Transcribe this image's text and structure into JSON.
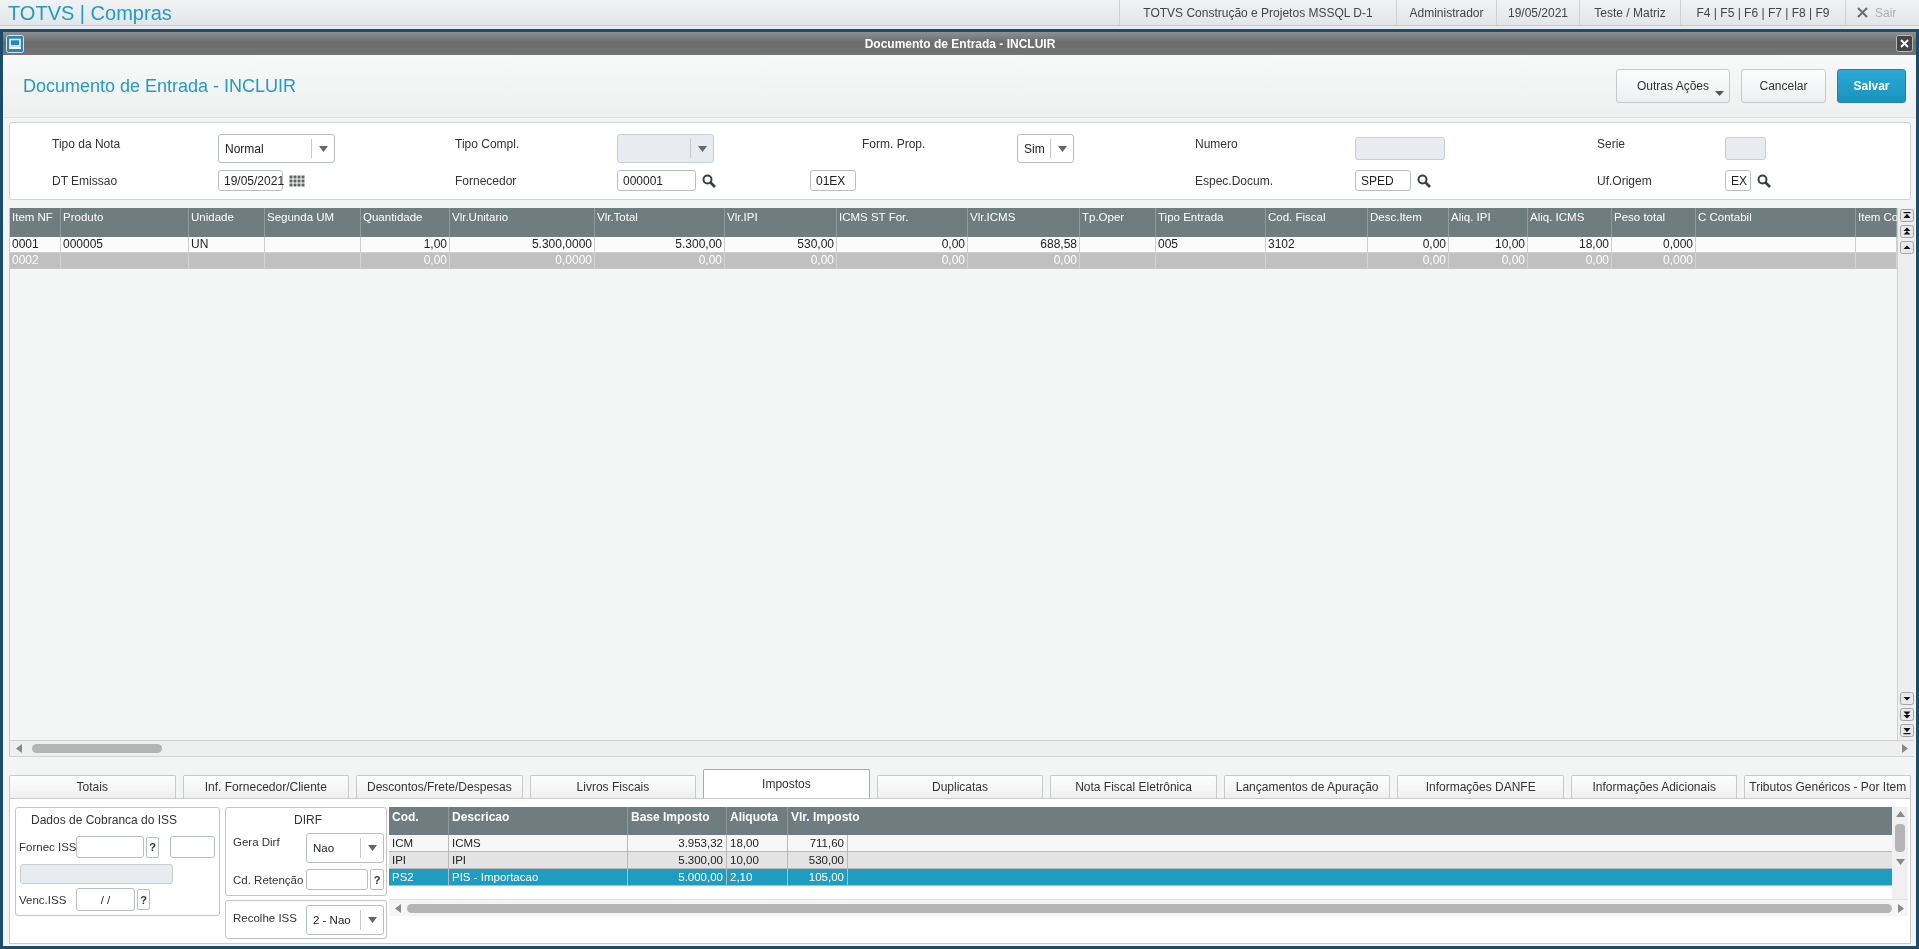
{
  "app_bar": {
    "brand": "TOTVS | Compras",
    "items": [
      "TOTVS Construção e Projetos MSSQL D-1",
      "Administrador",
      "19/05/2021",
      "Teste / Matriz",
      "F4 | F5 | F6 | F7 | F8 | F9"
    ],
    "exit": {
      "label": "Sair",
      "disabled": true
    }
  },
  "window": {
    "title": "Documento de Entrada - INCLUIR"
  },
  "header": {
    "title": "Documento de Entrada - INCLUIR",
    "buttons": [
      {
        "label": "Outras Ações",
        "kind": "menu"
      },
      {
        "label": "Cancelar",
        "kind": "secondary"
      },
      {
        "label": "Salvar",
        "kind": "primary"
      }
    ]
  },
  "form": {
    "rows": [
      {
        "fields": [
          {
            "label": "Tipo da Nota",
            "kind": "select",
            "value": "Normal",
            "disabled": false
          },
          {
            "label": "Tipo Compl.",
            "kind": "select",
            "disabled": true
          },
          {
            "label": "Form. Prop.",
            "kind": "select",
            "value": "Sim",
            "disabled": false
          },
          {
            "label": "Numero",
            "kind": "text",
            "disabled": true
          },
          {
            "label": "Serie",
            "kind": "text",
            "disabled": true
          }
        ]
      },
      {
        "fields": [
          {
            "label": "DT Emissao",
            "kind": "date",
            "value": "19/05/2021",
            "disabled": false
          },
          {
            "label": "Fornecedor",
            "kind": "lookup",
            "value": "000001",
            "extra_value": "01EX",
            "disabled": false
          },
          {
            "label": "Espec.Docum.",
            "kind": "lookup",
            "value": "SPED",
            "disabled": false
          },
          {
            "label": "Uf.Origem",
            "kind": "lookup",
            "value": "EX",
            "disabled": false
          }
        ]
      }
    ]
  },
  "items": {
    "columns": [
      "Item NF",
      "Produto",
      "Unidade",
      "Segunda UM",
      "Quantidade",
      "Vlr.Unitario",
      "Vlr.Total",
      "Vlr.IPI",
      "ICMS ST For.",
      "Vlr.ICMS",
      "Tp.Oper",
      "Tipo Entrada",
      "Cod. Fiscal",
      "Desc.Item",
      "Aliq. IPI",
      "Aliq. ICMS",
      "Peso total",
      "C Contabil",
      "Item Co"
    ],
    "rows": [
      {
        "cells": [
          "0001",
          "000005",
          "UN",
          null,
          "1,00",
          "5.300,0000",
          "5.300,00",
          "530,00",
          "0,00",
          "688,58",
          null,
          "005",
          "3102",
          "0,00",
          "10,00",
          "18,00",
          "0,000",
          null,
          null
        ],
        "disabled": false
      },
      {
        "cells": [
          "0002",
          null,
          null,
          null,
          "0,00",
          "0,0000",
          "0,00",
          "0,00",
          "0,00",
          "0,00",
          null,
          null,
          null,
          "0,00",
          "0,00",
          "0,00",
          "0,000",
          null,
          null
        ],
        "disabled": true
      }
    ]
  },
  "tabs": [
    {
      "label": "Totais",
      "selected": false
    },
    {
      "label": "Inf. Fornecedor/Cliente",
      "selected": false
    },
    {
      "label": "Descontos/Frete/Despesas",
      "selected": false
    },
    {
      "label": "Livros Fiscais",
      "selected": false
    },
    {
      "label": "Impostos",
      "selected": true
    },
    {
      "label": "Duplicatas",
      "selected": false
    },
    {
      "label": "Nota Fiscal Eletrônica",
      "selected": false
    },
    {
      "label": "Lançamentos de Apuração",
      "selected": false
    },
    {
      "label": "Informações DANFE",
      "selected": false
    },
    {
      "label": "Informações Adicionais",
      "selected": false
    },
    {
      "label": "Tributos Genéricos - Por Item",
      "selected": false
    }
  ],
  "iss_billing": {
    "title": "Dados de Cobranca do ISS",
    "supplier": {
      "label": "Fornec ISS",
      "help": "?"
    },
    "supplier_name": {
      "disabled": true
    },
    "due_date": {
      "label": "Venc.ISS",
      "value": "/ /",
      "help": "?"
    }
  },
  "dirf": {
    "title": "DIRF",
    "generate": {
      "label": "Gera Dirf",
      "value": "Nao"
    },
    "retention_code": {
      "label": "Cd. Retenção",
      "help": "?"
    }
  },
  "iss_collect": {
    "label": "Recolhe ISS",
    "value": "2 - Nao"
  },
  "taxes": {
    "columns": [
      "Cod.",
      "Descricao",
      "Base Imposto",
      "Aliquota",
      "Vlr. Imposto"
    ],
    "rows": [
      {
        "cells": [
          "ICM",
          "ICMS",
          "3.953,32",
          "18,00",
          "711,60"
        ],
        "selected": false
      },
      {
        "cells": [
          "IPI",
          "IPI",
          "5.300,00",
          "10,00",
          "530,00"
        ],
        "selected": false
      },
      {
        "cells": [
          "PS2",
          "PIS - Importacao",
          "5.000,00",
          "2,10",
          "105,00"
        ],
        "selected": true
      }
    ]
  }
}
